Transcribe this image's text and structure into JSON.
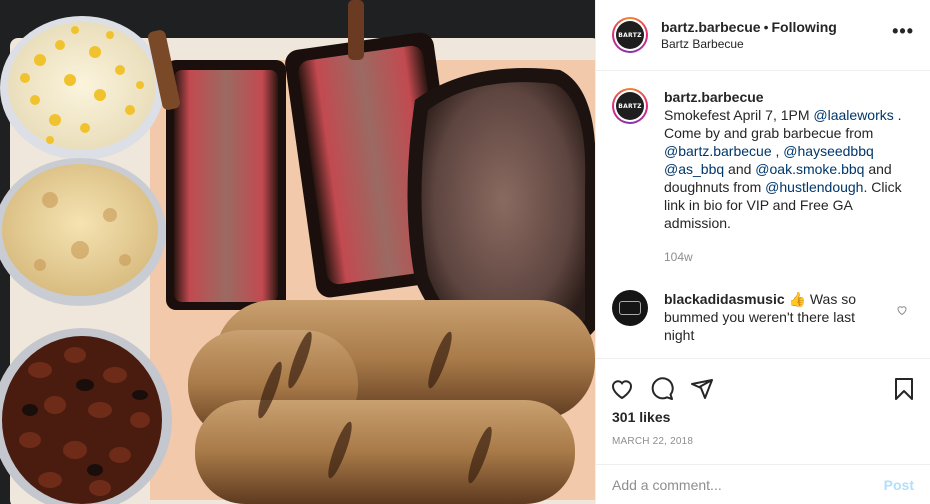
{
  "header": {
    "avatar_text": "BARTZ",
    "username": "bartz.barbecue",
    "separator": "•",
    "follow_status": "Following",
    "location": "Bartz Barbecue",
    "more_label": "•••"
  },
  "caption": {
    "username": "bartz.barbecue",
    "segments": [
      {
        "t": "Smokefest April 7, 1PM ",
        "m": false
      },
      {
        "t": "@laaleworks",
        "m": true
      },
      {
        "t": " . Come by and grab barbecue from ",
        "m": false
      },
      {
        "t": "@bartz.barbecue",
        "m": true
      },
      {
        "t": " , ",
        "m": false
      },
      {
        "t": "@hayseedbbq",
        "m": true
      },
      {
        "t": " ",
        "m": false
      },
      {
        "t": "@as_bbq",
        "m": true
      },
      {
        "t": " and ",
        "m": false
      },
      {
        "t": "@oak.smoke.bbq",
        "m": true
      },
      {
        "t": " and doughnuts from ",
        "m": false
      },
      {
        "t": "@hustlendough",
        "m": true
      },
      {
        "t": ". Click link in bio for VIP and Free GA admission.",
        "m": false
      }
    ],
    "time": "104w"
  },
  "comment": {
    "username": "blackadidasmusic",
    "text": "👍 Was so bummed you weren't there last night"
  },
  "actions": {
    "likes": "301 likes",
    "date": "MARCH 22, 2018"
  },
  "add_comment": {
    "placeholder": "Add a comment...",
    "post_label": "Post"
  },
  "icons": [
    "heart-icon",
    "comment-icon",
    "share-icon",
    "bookmark-icon",
    "more-icon",
    "small-heart-icon"
  ]
}
